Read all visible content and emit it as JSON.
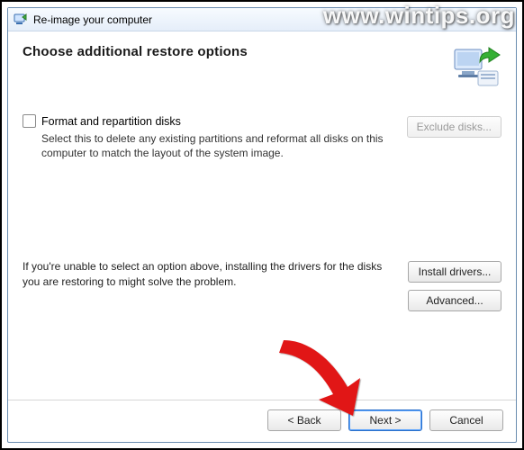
{
  "titlebar": {
    "title": "Re-image your computer"
  },
  "heading": "Choose additional restore options",
  "format_section": {
    "checkbox_label": "Format and repartition disks",
    "description": "Select this to delete any existing partitions and reformat all disks on this computer to match the layout of the system image.",
    "exclude_btn": "Exclude disks..."
  },
  "help_section": {
    "text": "If you're unable to select an option above, installing the drivers for the disks you are restoring to might solve the problem.",
    "install_btn": "Install drivers...",
    "advanced_btn": "Advanced..."
  },
  "footer": {
    "back": "< Back",
    "next": "Next >",
    "cancel": "Cancel"
  },
  "watermark": "www.wintips.org"
}
